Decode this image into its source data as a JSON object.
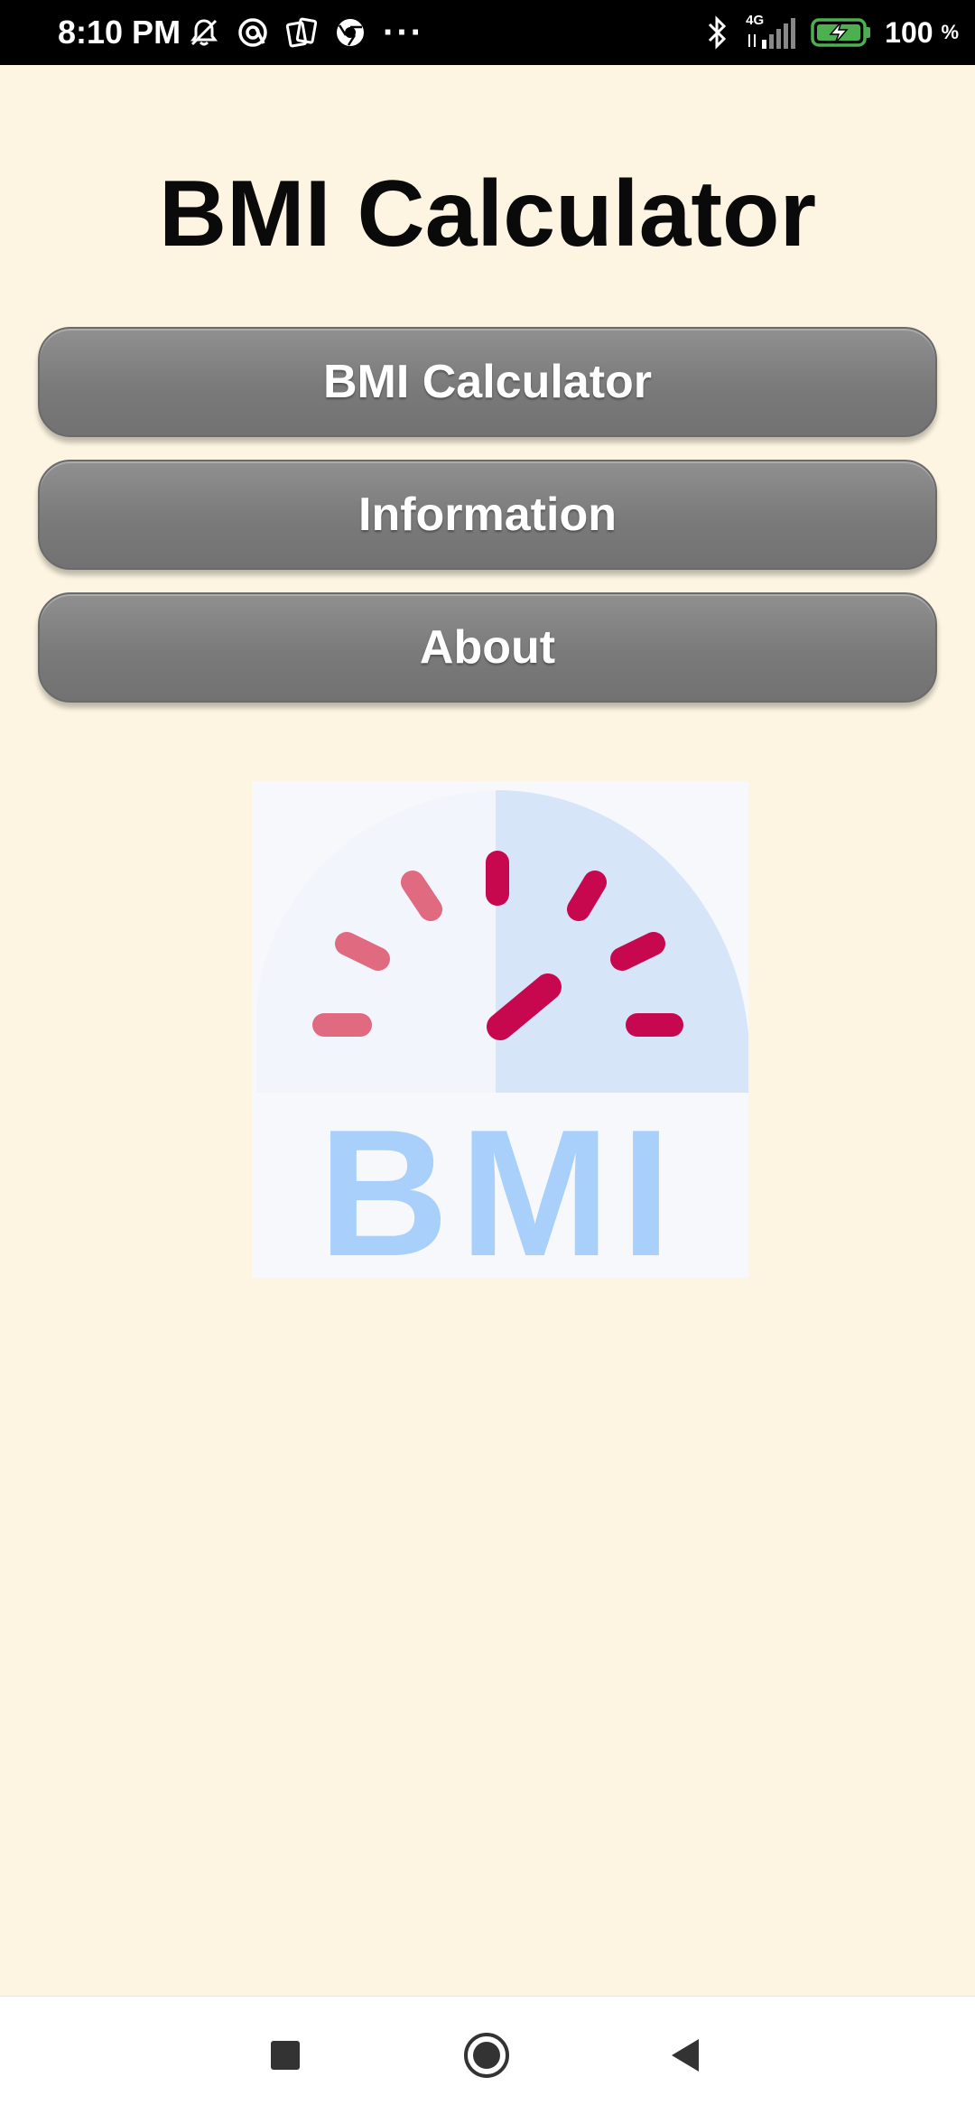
{
  "status_bar": {
    "time": "8:10 PM",
    "more_indicator": "···",
    "network_type": "4G",
    "battery_percent": "100",
    "battery_symbol": "%",
    "left_icons": [
      "notifications-off-icon",
      "vpn-icon",
      "cards-icon",
      "chrome-icon"
    ],
    "right_icons": [
      "bluetooth-icon",
      "signal-icon",
      "battery-charging-icon"
    ]
  },
  "page": {
    "title": "BMI Calculator"
  },
  "menu": {
    "buttons": [
      {
        "label": "BMI Calculator"
      },
      {
        "label": "Information"
      },
      {
        "label": "About"
      }
    ]
  },
  "logo": {
    "text": "BMI",
    "colors": {
      "gauge_background": "#f6f8fc",
      "gauge_accent": "#d7e5f8",
      "ticks_light": "#e06a80",
      "ticks_dark": "#c8084e",
      "letters": "#a9d0fb"
    }
  },
  "navigation_bar": {
    "buttons": [
      "recents-icon",
      "home-icon",
      "back-icon"
    ]
  },
  "colors": {
    "background": "#fdf5e1",
    "button": "#808080",
    "title": "#0a0a0a"
  }
}
